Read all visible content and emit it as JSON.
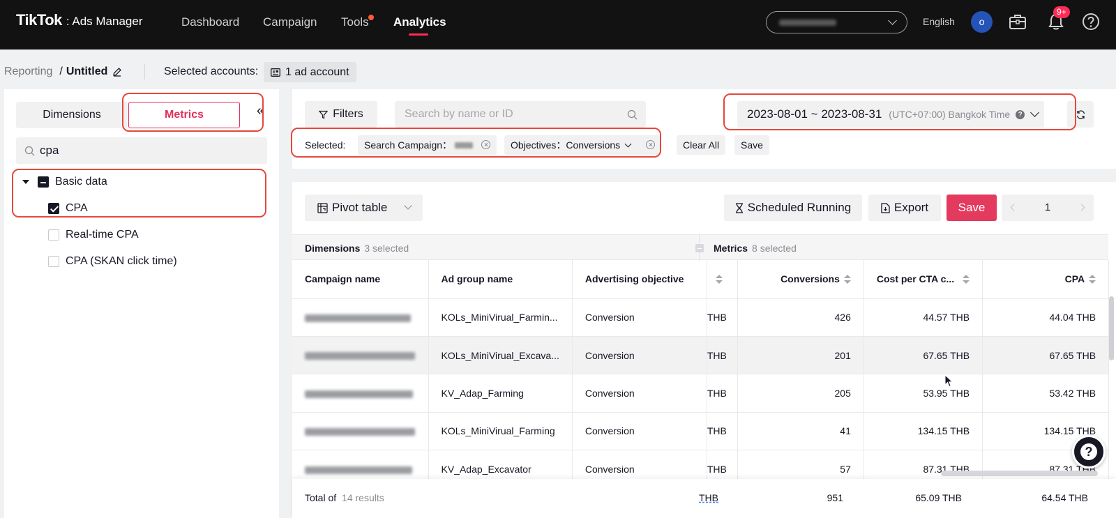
{
  "topbar": {
    "brand": "TikTok",
    "brand_sub": ": Ads Manager",
    "nav": [
      "Dashboard",
      "Campaign",
      "Tools",
      "Analytics"
    ],
    "active_nav": "Analytics",
    "language": "English",
    "avatar_initial": "o",
    "notification_badge": "9+"
  },
  "breadcrumb": {
    "root": "Reporting",
    "separator": "/",
    "title": "Untitled",
    "selected_accounts_label": "Selected accounts:",
    "account_chip": "1 ad account"
  },
  "left_panel": {
    "tab_dimensions": "Dimensions",
    "tab_metrics": "Metrics",
    "collapse_glyph": "«",
    "search_value": "cpa",
    "group_label": "Basic data",
    "items": [
      {
        "label": "CPA",
        "checked": true
      },
      {
        "label": "Real-time CPA",
        "checked": false
      },
      {
        "label": "CPA (SKAN click time)",
        "checked": false
      }
    ]
  },
  "filters": {
    "filters_button": "Filters",
    "search_placeholder": "Search by name or ID",
    "date_range": "2023-08-01 ~ 2023-08-31",
    "timezone": "(UTC+07:00) Bangkok Time",
    "selected_label": "Selected:",
    "chip_campaign": "Search Campaign：",
    "chip_objectives_key": "Objectives：",
    "chip_objectives_value": "Conversions",
    "clear_all": "Clear All",
    "save": "Save"
  },
  "toolbar": {
    "pivot": "Pivot table",
    "scheduled": "Scheduled Running",
    "export": "Export",
    "save": "Save",
    "page": "1"
  },
  "table": {
    "dimensions_label": "Dimensions",
    "dimensions_count": "3 selected",
    "metrics_label": "Metrics",
    "metrics_count": "8 selected",
    "headers": [
      "Campaign name",
      "Ad group name",
      "Advertising objective",
      "Conversions",
      "Cost per CTA c...",
      "CPA"
    ],
    "rows": [
      {
        "adgroup": "KOLs_MiniVirual_Farmin...",
        "objective": "Conversion",
        "cut": "THB",
        "conversions": "426",
        "cost_cta": "44.57 THB",
        "cpa": "44.04 THB"
      },
      {
        "adgroup": "KOLs_MiniVirual_Excava...",
        "objective": "Conversion",
        "cut": "THB",
        "conversions": "201",
        "cost_cta": "67.65 THB",
        "cpa": "67.65 THB"
      },
      {
        "adgroup": "KV_Adap_Farming",
        "objective": "Conversion",
        "cut": "THB",
        "conversions": "205",
        "cost_cta": "53.95 THB",
        "cpa": "53.42 THB"
      },
      {
        "adgroup": "KOLs_MiniVirual_Farming",
        "objective": "Conversion",
        "cut": "THB",
        "conversions": "41",
        "cost_cta": "134.15 THB",
        "cpa": "134.15 THB"
      },
      {
        "adgroup": "KV_Adap_Excavator",
        "objective": "Conversion",
        "cut": "THB",
        "conversions": "57",
        "cost_cta": "87.31 THB",
        "cpa": "87.31 THB"
      }
    ],
    "total_label": "Total of",
    "total_count": "14 results",
    "total_cut": "THB",
    "total_conversions": "951",
    "total_cost_cta": "65.09 THB",
    "total_cpa": "64.54 THB"
  },
  "help_fab": "?"
}
